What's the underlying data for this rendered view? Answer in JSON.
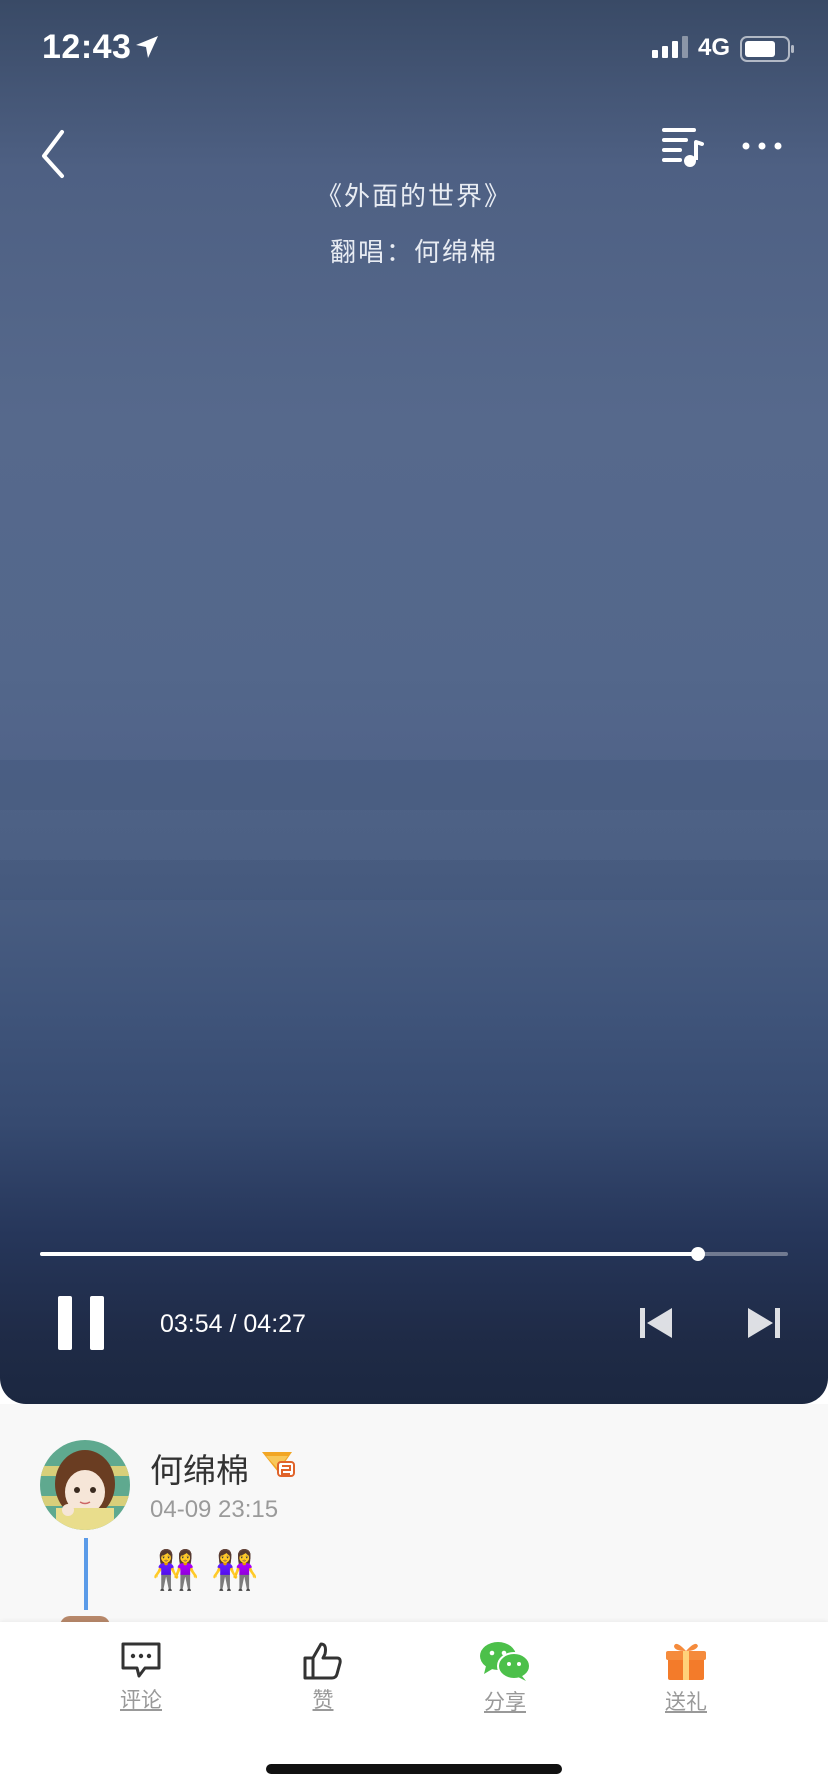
{
  "status_bar": {
    "time": "12:43",
    "network": "4G"
  },
  "song": {
    "title": "《外面的世界》",
    "singer_line": "翻唱：何绵棉"
  },
  "player": {
    "elapsed": "03:54",
    "duration": "04:27",
    "separator": " / ",
    "time_display": "03:54 / 04:27",
    "progress_fraction": 0.88
  },
  "post": {
    "user_name": "何绵棉",
    "timestamp": "04-09 23:15",
    "content_emoji": "👭 👭"
  },
  "tabbar": {
    "comment": "评论",
    "like": "赞",
    "share": "分享",
    "gift": "送礼"
  },
  "colors": {
    "share_green": "#4cc04a",
    "gift_orange": "#f37b2a",
    "thread_blue": "#5b9be8"
  },
  "icons": [
    "back-icon",
    "playlist-icon",
    "more-icon",
    "pause-icon",
    "previous-icon",
    "next-icon",
    "comment-icon",
    "like-icon",
    "wechat-icon",
    "gift-icon"
  ]
}
